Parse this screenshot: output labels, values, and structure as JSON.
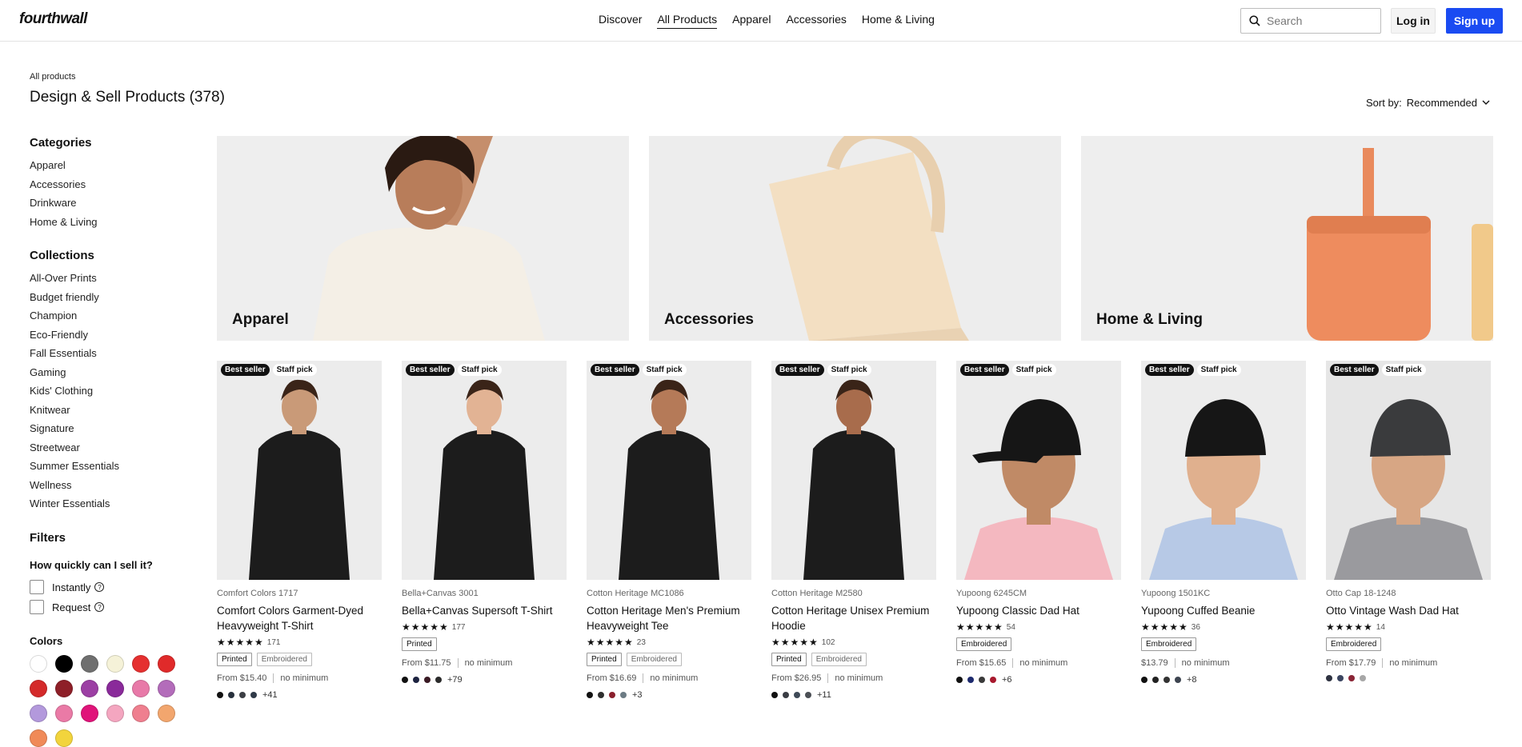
{
  "header": {
    "logo": "fourthwall",
    "nav": [
      "Discover",
      "All Products",
      "Apparel",
      "Accessories",
      "Home & Living"
    ],
    "search_placeholder": "Search",
    "login": "Log in",
    "signup": "Sign up"
  },
  "page": {
    "breadcrumb": "All products",
    "title": "Design & Sell Products (378)",
    "sort_label": "Sort by:",
    "sort_value": "Recommended"
  },
  "sidebar": {
    "categories_title": "Categories",
    "categories": [
      "Apparel",
      "Accessories",
      "Drinkware",
      "Home & Living"
    ],
    "collections_title": "Collections",
    "collections": [
      "All-Over Prints",
      "Budget friendly",
      "Champion",
      "Eco-Friendly",
      "Fall Essentials",
      "Gaming",
      "Kids' Clothing",
      "Knitwear",
      "Signature",
      "Streetwear",
      "Summer Essentials",
      "Wellness",
      "Winter Essentials"
    ],
    "filters_title": "Filters",
    "sell_question": "How quickly can I sell it?",
    "sell_options": [
      "Instantly",
      "Request"
    ],
    "colors_title": "Colors",
    "colors": [
      "#ffffff",
      "#000000",
      "#6f6f6f",
      "#f5f2d8",
      "#e53030",
      "#e02a2a",
      "#d42a2a",
      "#8e1f28",
      "#9c3fa4",
      "#8a2a9a",
      "#e879a8",
      "#b36cba",
      "#b399dc",
      "#ea7aa6",
      "#e0147a",
      "#f4a6c0",
      "#ef7f8f",
      "#f2a66e",
      "#f08a58",
      "#f2d43c"
    ]
  },
  "banners": [
    "Apparel",
    "Accessories",
    "Home & Living"
  ],
  "badges": {
    "best": "Best seller",
    "staff": "Staff pick"
  },
  "products": [
    {
      "brand": "Comfort Colors 1717",
      "name": "Comfort Colors Garment-Dyed Heavyweight T-Shirt",
      "stars": "★★★★★",
      "reviews": "171",
      "tags": [
        "Printed",
        "Embroidered"
      ],
      "price": "From $15.40",
      "minimum": "no minimum",
      "dots": [
        "#111111",
        "#27303c",
        "#3b3e44",
        "#2f3a48"
      ],
      "more": "+41"
    },
    {
      "brand": "Bella+Canvas 3001",
      "name": "Bella+Canvas Supersoft T-Shirt",
      "stars": "★★★★★",
      "reviews": "177",
      "tags": [
        "Printed"
      ],
      "price": "From $11.75",
      "minimum": "no minimum",
      "dots": [
        "#111111",
        "#1d2340",
        "#3a1a24",
        "#2b2b2b"
      ],
      "more": "+79"
    },
    {
      "brand": "Cotton Heritage MC1086",
      "name": "Cotton Heritage Men's Premium Heavyweight Tee",
      "stars": "★★★★★",
      "reviews": "23",
      "tags": [
        "Printed",
        "Embroidered"
      ],
      "price": "From $16.69",
      "minimum": "no minimum",
      "dots": [
        "#111111",
        "#2e2e2e",
        "#8a1f2c",
        "#6c7b84"
      ],
      "more": "+3"
    },
    {
      "brand": "Cotton Heritage M2580",
      "name": "Cotton Heritage Unisex Premium Hoodie",
      "stars": "★★★★★",
      "reviews": "102",
      "tags": [
        "Printed",
        "Embroidered"
      ],
      "price": "From $26.95",
      "minimum": "no minimum",
      "dots": [
        "#111111",
        "#3a3d44",
        "#3f4a57",
        "#4b4f55"
      ],
      "more": "+11"
    },
    {
      "brand": "Yupoong 6245CM",
      "name": "Yupoong Classic Dad Hat",
      "stars": "★★★★★",
      "reviews": "54",
      "tags": [
        "Embroidered"
      ],
      "price": "From $15.65",
      "minimum": "no minimum",
      "dots": [
        "#111111",
        "#1d2a6e",
        "#3a3a3a",
        "#a8192e"
      ],
      "more": "+6"
    },
    {
      "brand": "Yupoong 1501KC",
      "name": "Yupoong Cuffed Beanie",
      "stars": "★★★★★",
      "reviews": "36",
      "tags": [
        "Embroidered"
      ],
      "price": "$13.79",
      "minimum": "no minimum",
      "dots": [
        "#111111",
        "#222222",
        "#333333",
        "#3d4450"
      ],
      "more": "+8"
    },
    {
      "brand": "Otto Cap 18-1248",
      "name": "Otto Vintage Wash Dad Hat",
      "stars": "★★★★★",
      "reviews": "14",
      "tags": [
        "Embroidered"
      ],
      "price": "From $17.79",
      "minimum": "no minimum",
      "dots": [
        "#2e3240",
        "#3b4560",
        "#8a2536",
        "#a7a7a7"
      ],
      "more": ""
    }
  ]
}
